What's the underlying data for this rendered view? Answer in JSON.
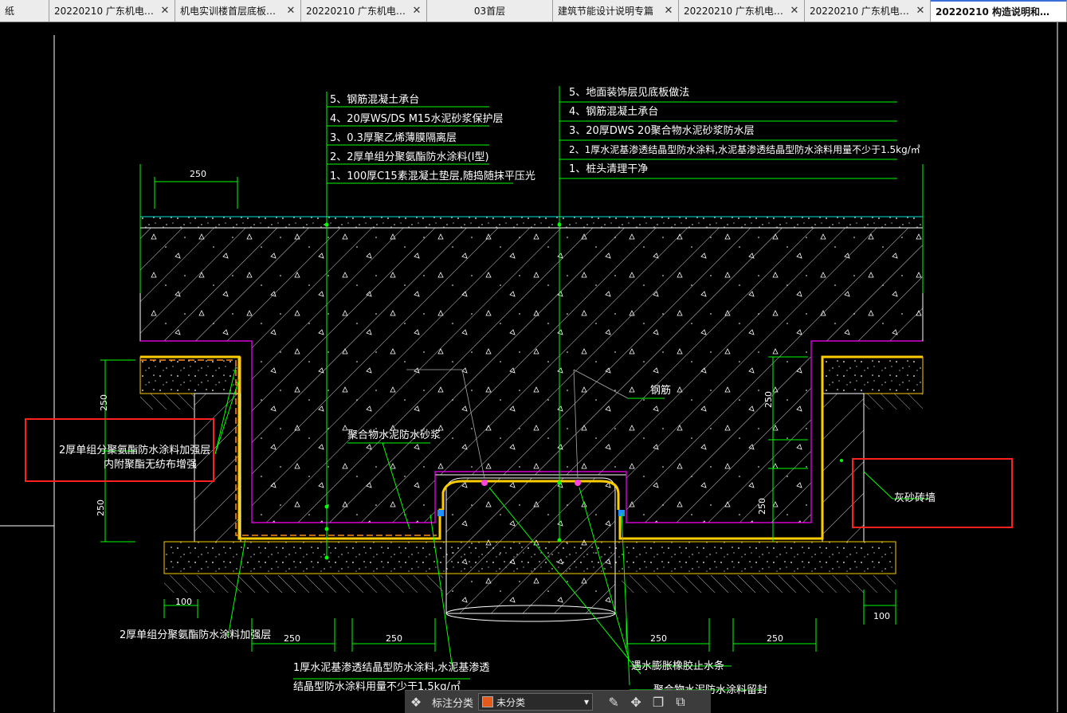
{
  "tabs": [
    {
      "label": "纸",
      "closable": false
    },
    {
      "label": "20220210 广东机电职…",
      "closable": true
    },
    {
      "label": "机电实训楼首层底板…",
      "closable": true
    },
    {
      "label": "20220210 广东机电职…",
      "closable": true
    },
    {
      "label": "03首层",
      "closable": false
    },
    {
      "label": "建筑节能设计说明专篇",
      "closable": true
    },
    {
      "label": "20220210 广东机电职…",
      "closable": true
    },
    {
      "label": "20220210 广东机电职…",
      "closable": true
    },
    {
      "label": "20220210 构造说明和…",
      "closable": false,
      "active": true
    }
  ],
  "drawing": {
    "left_notes": [
      "5、钢筋混凝土承台",
      "4、20厚WS/DS M15水泥砂浆保护层",
      "3、0.3厚聚乙烯薄膜隔离层",
      "2、2厚单组分聚氨酯防水涂料(I型)",
      "1、100厚C15素混凝土垫层,随捣随抹平压光"
    ],
    "right_notes": [
      "5、地面装饰层见底板做法",
      "4、钢筋混凝土承台",
      "3、20厚DWS 20聚合物水泥砂浆防水层",
      "2、1厚水泥基渗透结晶型防水涂料,水泥基渗透结晶型防水涂料用量不少于1.5kg/㎡",
      "1、桩头清理干净"
    ],
    "callouts": {
      "reinforce_layer_1": "2厚单组分聚氨酯防水涂料加强层",
      "reinforce_layer_2": "内附聚酯无纺布增强",
      "polymer_mortar": "聚合物水泥防水砂浆",
      "rebar": "钢筋",
      "brick_wall": "灰砂砖墙",
      "bottom_reinforce": "2厚单组分聚氨酯防水涂料加强层",
      "bottom_note_1": "1厚水泥基渗透结晶型防水涂料,水泥基渗透",
      "bottom_note_2": "结晶型防水涂料用量不少于1.5kg/㎡",
      "water_stop": "遇水膨胀橡胶止水条",
      "seal": "聚合物水泥防水涂料留封"
    },
    "dims": {
      "d250_top": "250",
      "d250_v1": "250",
      "d250_v2": "250",
      "d100_left": "100",
      "d250_b1": "250",
      "d250_b2": "250",
      "d250_b3": "250",
      "d250_b4": "250",
      "d250_rv1": "250",
      "d250_rv2": "250",
      "d100_right": "100"
    }
  },
  "toolbar": {
    "label": "标注分类",
    "category_value": "未分类",
    "category_color": "#e25a1c"
  },
  "colors": {
    "background": "#000000",
    "leader": "#00ff00",
    "highlight_box": "#ff2020",
    "membrane": "#ff00ff",
    "waterproof": "#ffcc00"
  }
}
